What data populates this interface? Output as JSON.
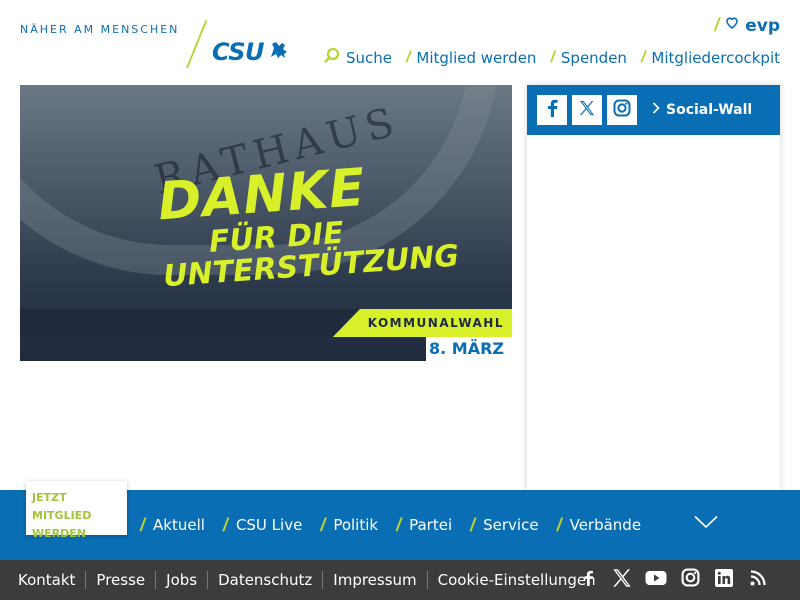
{
  "header": {
    "tagline": "NÄHER AM MENSCHEN",
    "logo_text": "CSU",
    "partner_logo": "evp",
    "nav": [
      {
        "label": "Suche",
        "icon": "search-icon"
      },
      {
        "label": "Mitglied werden"
      },
      {
        "label": "Spenden"
      },
      {
        "label": "Mitgliedercockpit"
      }
    ]
  },
  "hero": {
    "building_text": "RATHAUS",
    "headline_1": "DANKE",
    "headline_2": "FÜR DIE",
    "headline_3": "UNTERSTÜTZUNG",
    "subline": "KOMMUNALWAHL",
    "date": "8. MÄRZ"
  },
  "social": {
    "icons": [
      "facebook-icon",
      "x-icon",
      "instagram-icon"
    ],
    "link_label": "Social-Wall"
  },
  "mainnav": {
    "join_label": "JETZT MITGLIED WERDEN",
    "items": [
      {
        "label": "Aktuell"
      },
      {
        "label": "CSU Live"
      },
      {
        "label": "Politik"
      },
      {
        "label": "Partei"
      },
      {
        "label": "Service"
      },
      {
        "label": "Verbände"
      }
    ]
  },
  "footer": {
    "links": [
      {
        "label": "Kontakt"
      },
      {
        "label": "Presse"
      },
      {
        "label": "Jobs"
      },
      {
        "label": "Datenschutz"
      },
      {
        "label": "Impressum"
      },
      {
        "label": "Cookie-Einstellungen"
      }
    ],
    "icons": [
      "facebook-icon",
      "x-icon",
      "youtube-icon",
      "instagram-icon",
      "linkedin-icon",
      "rss-icon"
    ]
  },
  "colors": {
    "brand_blue": "#0a6eb4",
    "accent_green": "#b7d433",
    "hero_yellow": "#d7f02a",
    "footer_bg": "#3c3c3c"
  }
}
